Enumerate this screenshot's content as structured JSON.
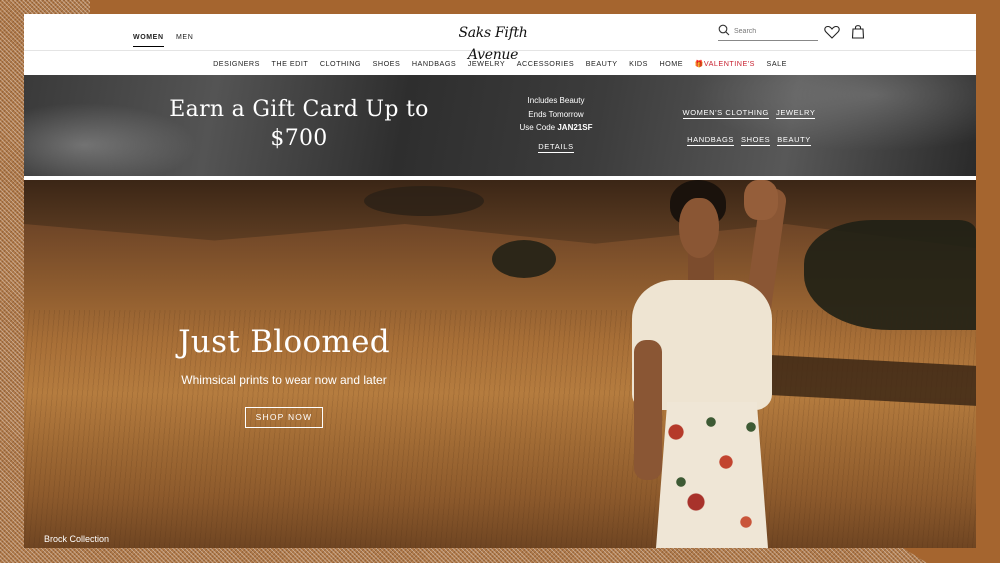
{
  "header": {
    "tabs": [
      {
        "label": "WOMEN",
        "active": true
      },
      {
        "label": "MEN",
        "active": false
      }
    ],
    "logo_text": "Saks Fifth Avenue",
    "search": {
      "placeholder": "Search",
      "value": ""
    },
    "icons": [
      "search-icon",
      "heart-icon",
      "shopping-bag-icon"
    ]
  },
  "nav": {
    "items": [
      {
        "label": "DESIGNERS"
      },
      {
        "label": "THE EDIT"
      },
      {
        "label": "CLOTHING"
      },
      {
        "label": "SHOES"
      },
      {
        "label": "HANDBAGS"
      },
      {
        "label": "JEWELRY"
      },
      {
        "label": "ACCESSORIES"
      },
      {
        "label": "BEAUTY"
      },
      {
        "label": "KIDS"
      },
      {
        "label": "HOME"
      },
      {
        "label": "VALENTINE'S",
        "icon": "gift-icon",
        "color": "#c8202f"
      },
      {
        "label": "SALE"
      }
    ]
  },
  "promo": {
    "title": "Earn a Gift Card Up to $700",
    "line1": "Includes Beauty",
    "line2": "Ends Tomorrow",
    "code_prefix": "Use Code",
    "code": "JAN21SF",
    "details_label": "DETAILS",
    "links_row1": [
      "WOMEN'S CLOTHING",
      "JEWELRY"
    ],
    "links_row2": [
      "HANDBAGS",
      "SHOES",
      "BEAUTY"
    ]
  },
  "hero": {
    "title": "Just Bloomed",
    "subtitle": "Whimsical prints to wear now and later",
    "cta_label": "SHOP NOW",
    "credit": "Brock Collection"
  },
  "colors": {
    "accent_valentine": "#c8202f",
    "frame": "#a5652f"
  }
}
